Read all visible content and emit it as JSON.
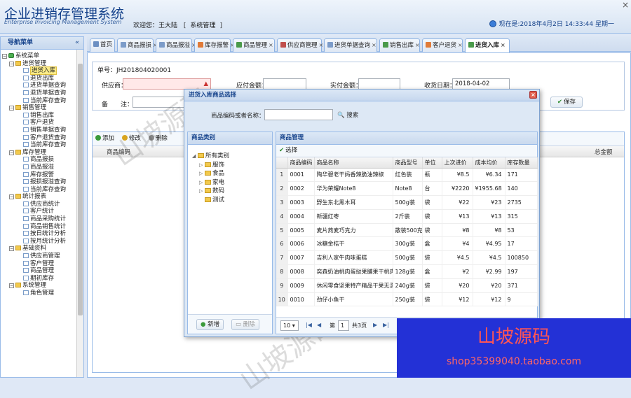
{
  "app": {
    "title": "企业进销存管理系统",
    "subtitle": "Enterprise Invoicing Management System",
    "welcome_prefix": "欢迎您：",
    "user": "王大陆",
    "bracket_open": "[",
    "bracket_close": "]",
    "system_admin": "系统管理",
    "clock_text": "现在是:2018年4月2日 14:33:44 星期一"
  },
  "sidebar": {
    "title": "导航菜单",
    "collapse": "«",
    "tree": [
      {
        "label": "系统菜单",
        "level": 0,
        "type": "root"
      },
      {
        "label": "进货管理",
        "level": 1,
        "type": "folder"
      },
      {
        "label": "进货入库",
        "level": 2,
        "type": "page",
        "selected": true
      },
      {
        "label": "退货出库",
        "level": 2,
        "type": "page"
      },
      {
        "label": "进货单据查询",
        "level": 2,
        "type": "page"
      },
      {
        "label": "退货单据查询",
        "level": 2,
        "type": "page"
      },
      {
        "label": "当前库存查询",
        "level": 2,
        "type": "page"
      },
      {
        "label": "销售管理",
        "level": 1,
        "type": "folder"
      },
      {
        "label": "销售出库",
        "level": 2,
        "type": "page"
      },
      {
        "label": "客户退货",
        "level": 2,
        "type": "page"
      },
      {
        "label": "销售单据查询",
        "level": 2,
        "type": "page"
      },
      {
        "label": "客户退货查询",
        "level": 2,
        "type": "page"
      },
      {
        "label": "当前库存查询",
        "level": 2,
        "type": "page"
      },
      {
        "label": "库存管理",
        "level": 1,
        "type": "folder"
      },
      {
        "label": "商品报损",
        "level": 2,
        "type": "page"
      },
      {
        "label": "商品报溢",
        "level": 2,
        "type": "page"
      },
      {
        "label": "库存报警",
        "level": 2,
        "type": "page"
      },
      {
        "label": "报损报溢查询",
        "level": 2,
        "type": "page"
      },
      {
        "label": "当前库存查询",
        "level": 2,
        "type": "page"
      },
      {
        "label": "统计报表",
        "level": 1,
        "type": "folder"
      },
      {
        "label": "供应商统计",
        "level": 2,
        "type": "page"
      },
      {
        "label": "客户统计",
        "level": 2,
        "type": "page"
      },
      {
        "label": "商品采购统计",
        "level": 2,
        "type": "page"
      },
      {
        "label": "商品销售统计",
        "level": 2,
        "type": "page"
      },
      {
        "label": "按日统计分析",
        "level": 2,
        "type": "page"
      },
      {
        "label": "按月统计分析",
        "level": 2,
        "type": "page"
      },
      {
        "label": "基础资料",
        "level": 1,
        "type": "folder"
      },
      {
        "label": "供应商管理",
        "level": 2,
        "type": "page"
      },
      {
        "label": "客户管理",
        "level": 2,
        "type": "page"
      },
      {
        "label": "商品管理",
        "level": 2,
        "type": "page"
      },
      {
        "label": "期初库存",
        "level": 2,
        "type": "page"
      },
      {
        "label": "系统管理",
        "level": 1,
        "type": "folder"
      },
      {
        "label": "角色管理",
        "level": 2,
        "type": "page"
      }
    ]
  },
  "tabs": [
    {
      "label": "首页",
      "closable": false,
      "color": "#6b8fc2"
    },
    {
      "label": "商品报损",
      "closable": true,
      "color": "#7c9cc9"
    },
    {
      "label": "商品报溢",
      "closable": true,
      "color": "#7c9cc9"
    },
    {
      "label": "库存报警",
      "closable": true,
      "color": "#e07b39"
    },
    {
      "label": "商品管理",
      "closable": true,
      "color": "#4a9a4a"
    },
    {
      "label": "供应商管理",
      "closable": true,
      "color": "#c0504d"
    },
    {
      "label": "进货单据查询",
      "closable": true,
      "color": "#7c9cc9"
    },
    {
      "label": "销售出库",
      "closable": true,
      "color": "#4a9a4a"
    },
    {
      "label": "客户退货",
      "closable": true,
      "color": "#e07b39"
    },
    {
      "label": "进货入库",
      "closable": true,
      "active": true,
      "color": "#4a9a4a"
    }
  ],
  "form": {
    "order_no": "单号：JH201804020001",
    "supplier_label": "供应商：",
    "payable_label": "应付金额：",
    "paid_label": "实付金额：",
    "date_label": "收货日期：",
    "date_value": "2018-04-02",
    "remark_label": "备　　注：",
    "save_label": "保存"
  },
  "grid": {
    "add_label": "添加",
    "edit_label": "修改",
    "delete_label": "删除",
    "col_code": "商品编码",
    "col_total": "总金额"
  },
  "dialog": {
    "title": "进货入库商品选择",
    "search_label": "商品编码或者名称：",
    "search_button": "搜索",
    "category_title": "商品类别",
    "categories_root": "所有类别",
    "categories": [
      "服饰",
      "食品",
      "家电",
      "数码",
      "测试"
    ],
    "add_cat": "新增",
    "del_cat": "删除",
    "product_title": "商品管理",
    "select_label": "选择",
    "columns": [
      "商品编码",
      "商品名称",
      "商品型号",
      "单位",
      "上次进价",
      "成本均价",
      "库存数量"
    ],
    "rows": [
      {
        "idx": "1",
        "code": "0001",
        "name": "陶华碧老干妈香辣脆油辣椒",
        "model": "红色装",
        "unit": "瓶",
        "last": "¥8.5",
        "avg": "¥6.34",
        "qty": "171"
      },
      {
        "idx": "2",
        "code": "0002",
        "name": "华为荣耀Note8",
        "model": "Note8",
        "unit": "台",
        "last": "¥2220",
        "avg": "¥1955.68",
        "qty": "140"
      },
      {
        "idx": "3",
        "code": "0003",
        "name": "野生东北黑木耳",
        "model": "500g装",
        "unit": "袋",
        "last": "¥22",
        "avg": "¥23",
        "qty": "2735"
      },
      {
        "idx": "4",
        "code": "0004",
        "name": "新疆红枣",
        "model": "2斤装",
        "unit": "袋",
        "last": "¥13",
        "avg": "¥13",
        "qty": "315"
      },
      {
        "idx": "5",
        "code": "0005",
        "name": "麦片燕麦巧克力",
        "model": "散装500克",
        "unit": "袋",
        "last": "¥8",
        "avg": "¥8",
        "qty": "53"
      },
      {
        "idx": "6",
        "code": "0006",
        "name": "冰糖金桔干",
        "model": "300g装",
        "unit": "盒",
        "last": "¥4",
        "avg": "¥4.95",
        "qty": "17"
      },
      {
        "idx": "7",
        "code": "0007",
        "name": "吉利人家牛肉味蛋糕",
        "model": "500g装",
        "unit": "袋",
        "last": "¥4.5",
        "avg": "¥4.5",
        "qty": "100850"
      },
      {
        "idx": "8",
        "code": "0008",
        "name": "奕森奶油桃肉蛋挞果脯果干桃肉干",
        "model": "128g装",
        "unit": "盒",
        "last": "¥2",
        "avg": "¥2.99",
        "qty": "197"
      },
      {
        "idx": "9",
        "code": "0009",
        "name": "休闲零食坚果特产精品干果无漂白",
        "model": "240g装",
        "unit": "袋",
        "last": "¥20",
        "avg": "¥20",
        "qty": "371"
      },
      {
        "idx": "10",
        "code": "0010",
        "name": "劲仔小鱼干",
        "model": "250g装",
        "unit": "袋",
        "last": "¥12",
        "avg": "¥12",
        "qty": "9"
      }
    ],
    "page_size": "10",
    "page_prefix": "第",
    "page_value": "1",
    "page_total": "共3页"
  },
  "watermark": {
    "text1": "山坡源码",
    "text2": "山坡源码"
  },
  "promo": {
    "title": "山坡源码",
    "url": "shop35399040.taobao.com"
  }
}
